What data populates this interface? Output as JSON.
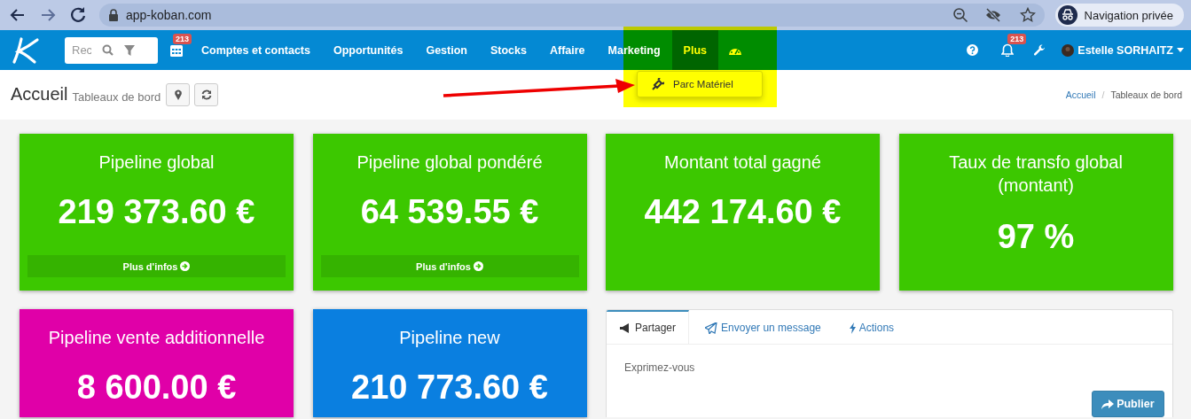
{
  "browser": {
    "url": "app-koban.com",
    "incognito_label": "Navigation privée"
  },
  "navbar": {
    "search": {
      "placeholder": "Rec"
    },
    "calendar_badge": "213",
    "menu": [
      {
        "label": "Comptes et contacts",
        "selected": false
      },
      {
        "label": "Opportunités",
        "selected": false
      },
      {
        "label": "Gestion",
        "selected": false
      },
      {
        "label": "Stocks",
        "selected": false
      },
      {
        "label": "Affaire",
        "selected": false
      },
      {
        "label": "Marketing",
        "selected": false
      },
      {
        "label": "Plus",
        "selected": true
      }
    ],
    "notifications_badge": "213",
    "user": "Estelle SORHAITZ"
  },
  "dropdown": {
    "items": [
      {
        "label": "Parc Matériel"
      }
    ]
  },
  "header": {
    "title": "Accueil",
    "subtitle": "Tableaux de bord",
    "breadcrumb": [
      "Accueil",
      "/",
      "Tableaux de bord"
    ]
  },
  "cards": [
    {
      "title": "Pipeline global",
      "value": "219 373.60 €",
      "link": "Plus d'infos",
      "color": "#3cc800"
    },
    {
      "title": "Pipeline global pondéré",
      "value": "64 539.55 €",
      "link": "Plus d'infos",
      "color": "#3cc800"
    },
    {
      "title": "Montant total gagné",
      "value": "442 174.60 €",
      "color": "#3cc800"
    },
    {
      "title": "Taux de transfo global (montant)",
      "value": "97 %",
      "color": "#3cc800"
    },
    {
      "title": "Pipeline vente additionnelle",
      "value": "8 600.00 €",
      "color": "#e000a8"
    },
    {
      "title": "Pipeline new",
      "value": "210 773.60 €",
      "color": "#0a7fe0"
    }
  ],
  "share": {
    "tabs": [
      {
        "label": "Partager",
        "selected": true
      },
      {
        "label": "Envoyer un message",
        "selected": false
      },
      {
        "label": "Actions",
        "selected": false
      }
    ],
    "placeholder": "Exprimez-vous",
    "button": "Publier"
  }
}
